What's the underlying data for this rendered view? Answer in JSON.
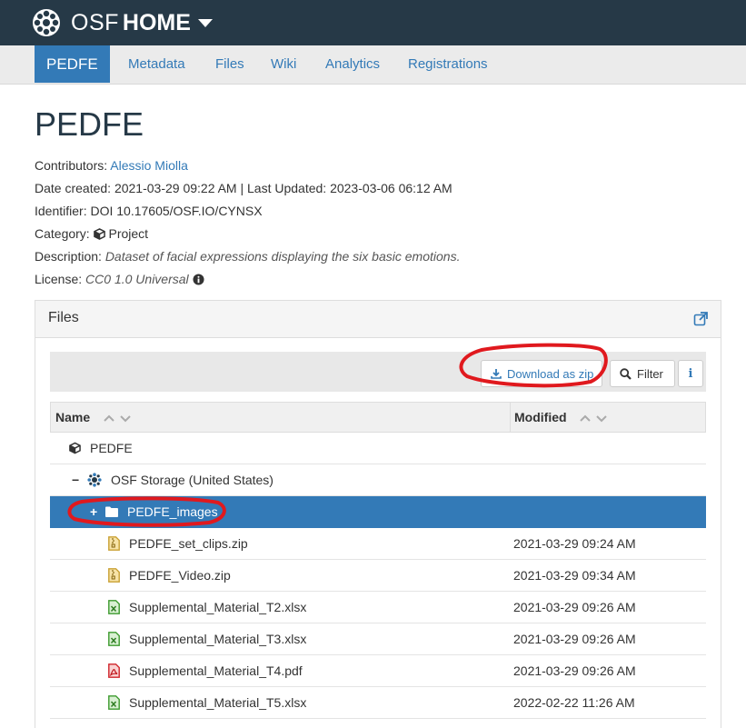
{
  "nav": {
    "brand_osf": "OSF",
    "brand_home": "HOME",
    "tabs": [
      {
        "label": "PEDFE",
        "active": true
      },
      {
        "label": "Metadata"
      },
      {
        "label": "Files"
      },
      {
        "label": "Wiki"
      },
      {
        "label": "Analytics"
      },
      {
        "label": "Registrations"
      }
    ]
  },
  "project": {
    "title": "PEDFE",
    "contributors_label": "Contributors:",
    "contributor": "Alessio Miolla",
    "dates": "Date created: 2021-03-29 09:22 AM | Last Updated: 2023-03-06 06:12 AM",
    "identifier": "Identifier: DOI 10.17605/OSF.IO/CYNSX",
    "category_label": "Category:",
    "category": "Project",
    "description_label": "Description:",
    "description": "Dataset of facial expressions displaying the six basic emotions.",
    "license_label": "License:",
    "license": "CC0 1.0 Universal"
  },
  "files": {
    "panel_title": "Files",
    "download_zip": "Download as zip",
    "filter": "Filter",
    "info": "i",
    "col_name": "Name",
    "col_modified": "Modified",
    "rows": [
      {
        "name": "PEDFE",
        "modified": "",
        "icon": "cube-icon"
      },
      {
        "name": "OSF Storage (United States)",
        "modified": "",
        "icon": "osf-storage-icon",
        "toggle": "−"
      },
      {
        "name": "PEDFE_images",
        "modified": "",
        "icon": "folder-icon",
        "toggle": "+",
        "selected": true
      },
      {
        "name": "PEDFE_set_clips.zip",
        "modified": "2021-03-29 09:24 AM",
        "icon": "zip-file-icon"
      },
      {
        "name": "PEDFE_Video.zip",
        "modified": "2021-03-29 09:34 AM",
        "icon": "zip-file-icon"
      },
      {
        "name": "Supplemental_Material_T2.xlsx",
        "modified": "2021-03-29 09:26 AM",
        "icon": "excel-file-icon"
      },
      {
        "name": "Supplemental_Material_T3.xlsx",
        "modified": "2021-03-29 09:26 AM",
        "icon": "excel-file-icon"
      },
      {
        "name": "Supplemental_Material_T4.pdf",
        "modified": "2021-03-29 09:26 AM",
        "icon": "pdf-file-icon"
      },
      {
        "name": "Supplemental_Material_T5.xlsx",
        "modified": "2022-02-22 11:26 AM",
        "icon": "excel-file-icon"
      }
    ]
  },
  "colors": {
    "navbar": "#263947",
    "accent": "#337ab7",
    "annotation": "#e0191e"
  }
}
